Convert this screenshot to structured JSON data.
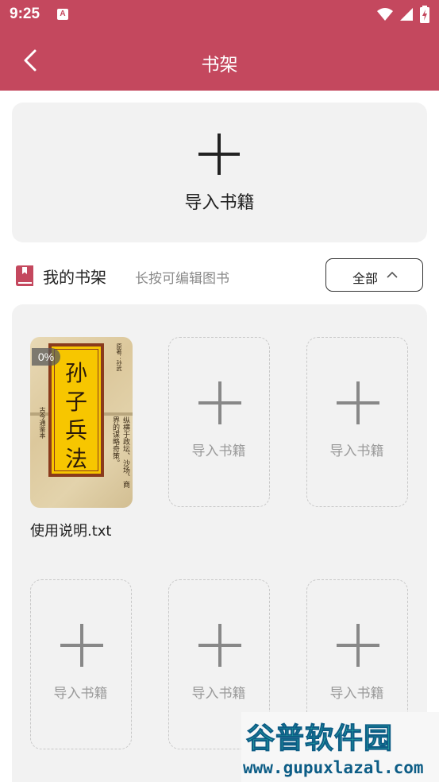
{
  "status_bar": {
    "time": "9:25",
    "notification": "A"
  },
  "app_bar": {
    "title": "书架"
  },
  "import_card": {
    "label": "导入书籍"
  },
  "shelf_header": {
    "title": "我的书架",
    "hint": "长按可编辑图书",
    "filter_label": "全部"
  },
  "books": [
    {
      "name": "使用说明.txt",
      "progress": "0%",
      "cover_title_chars": [
        "孙",
        "子",
        "兵",
        "法"
      ],
      "cover_side_left": "古今通鉴本",
      "cover_side_author": "原著：孙武",
      "cover_side_right_1": "纵横于政坛、沙场、商",
      "cover_side_right_2": "界的谋略奇策。"
    }
  ],
  "empty_slot_label": "导入书籍",
  "empty_slots": [
    {
      "label": "导入书籍"
    },
    {
      "label": "导入书籍"
    },
    {
      "label": "导入书籍"
    },
    {
      "label": "导入书籍"
    },
    {
      "label": "导入书籍"
    }
  ],
  "watermark": {
    "title": "谷普软件园",
    "url": "www.gupuxlazal.com"
  },
  "colors": {
    "primary": "#c4485e",
    "panel": "#f2f2f2",
    "text": "#222222",
    "muted": "#8a8a8a"
  }
}
